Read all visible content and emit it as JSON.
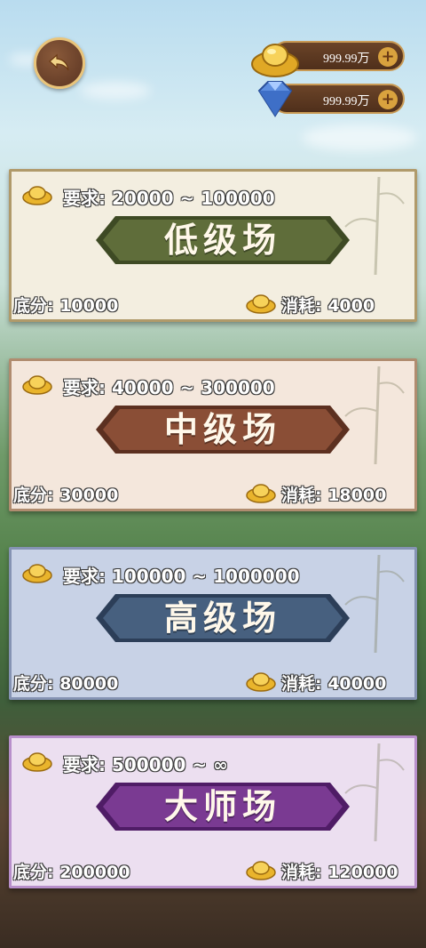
{
  "header": {
    "gold": {
      "value": "999.99万",
      "plus": "+"
    },
    "diamond": {
      "value": "999.99万",
      "plus": "+"
    }
  },
  "rooms": [
    {
      "requirement": "要求: 20000 ~ 100000",
      "title": "低级场",
      "base_score": "底分: 10000",
      "cost": "消耗: 4000",
      "theme": {
        "bg": "#f3eee0",
        "border": "#b09a6a",
        "banner": "#5f6d3a",
        "banner_edge": "#3e4a24"
      }
    },
    {
      "requirement": "要求: 40000 ~ 300000",
      "title": "中级场",
      "base_score": "底分: 30000",
      "cost": "消耗: 18000",
      "theme": {
        "bg": "#f4e7dc",
        "border": "#b08c6f",
        "banner": "#8a4e36",
        "banner_edge": "#5c3020"
      }
    },
    {
      "requirement": "要求: 100000 ~ 1000000",
      "title": "高级场",
      "base_score": "底分: 80000",
      "cost": "消耗: 40000",
      "theme": {
        "bg": "#c8d2e6",
        "border": "#8593b3",
        "banner": "#47607f",
        "banner_edge": "#2c3e58"
      }
    },
    {
      "requirement": "要求: 500000 ~ ∞",
      "title": "大师场",
      "base_score": "底分: 200000",
      "cost": "消耗: 120000",
      "theme": {
        "bg": "#ecdff0",
        "border": "#b88fcb",
        "banner": "#7a3a92",
        "banner_edge": "#4f1c66"
      }
    }
  ],
  "icons": {
    "back": "back-arrow-icon",
    "gold": "gold-ingot-icon",
    "diamond": "diamond-icon"
  }
}
